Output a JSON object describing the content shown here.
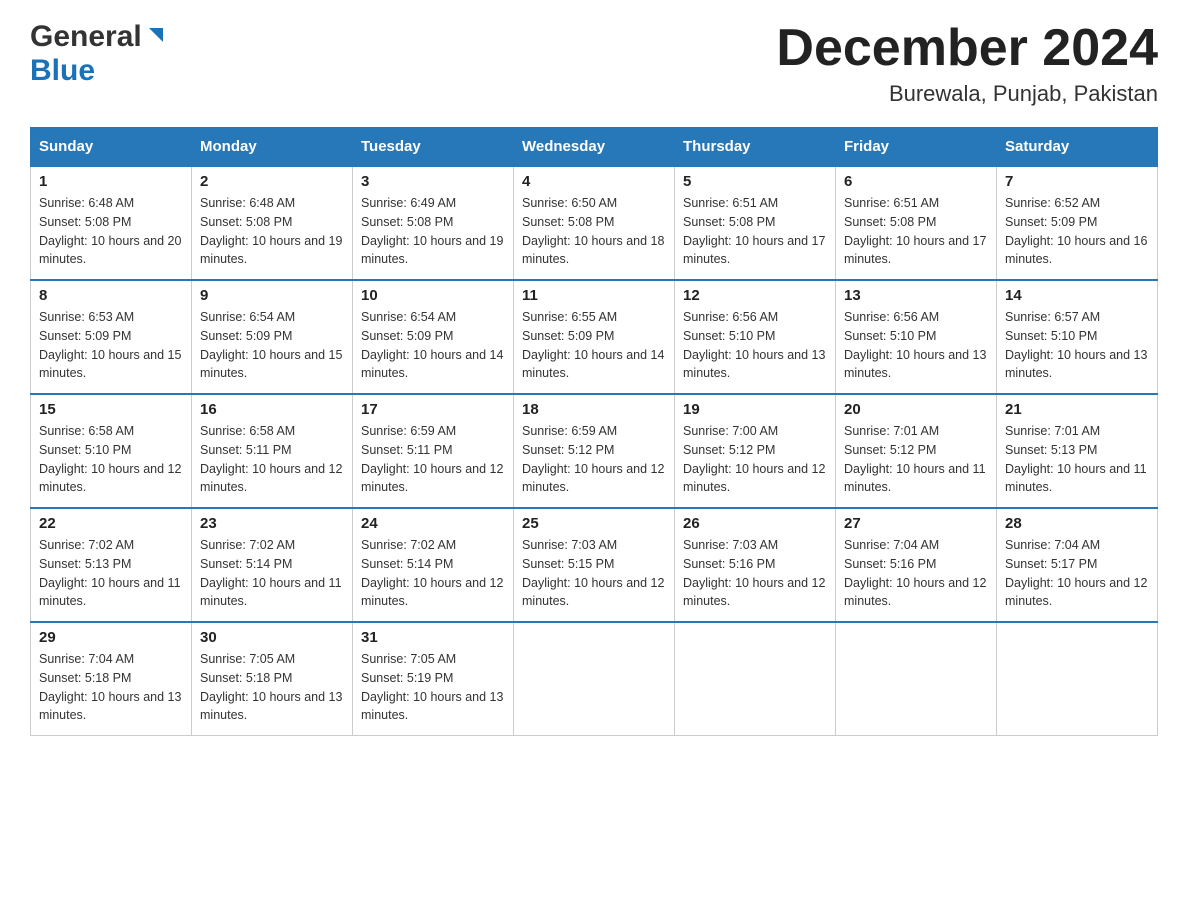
{
  "header": {
    "logo": {
      "general_text": "General",
      "blue_text": "Blue"
    },
    "title": "December 2024",
    "location": "Burewala, Punjab, Pakistan"
  },
  "weekdays": [
    "Sunday",
    "Monday",
    "Tuesday",
    "Wednesday",
    "Thursday",
    "Friday",
    "Saturday"
  ],
  "weeks": [
    [
      {
        "day": "1",
        "sunrise": "6:48 AM",
        "sunset": "5:08 PM",
        "daylight": "10 hours and 20 minutes."
      },
      {
        "day": "2",
        "sunrise": "6:48 AM",
        "sunset": "5:08 PM",
        "daylight": "10 hours and 19 minutes."
      },
      {
        "day": "3",
        "sunrise": "6:49 AM",
        "sunset": "5:08 PM",
        "daylight": "10 hours and 19 minutes."
      },
      {
        "day": "4",
        "sunrise": "6:50 AM",
        "sunset": "5:08 PM",
        "daylight": "10 hours and 18 minutes."
      },
      {
        "day": "5",
        "sunrise": "6:51 AM",
        "sunset": "5:08 PM",
        "daylight": "10 hours and 17 minutes."
      },
      {
        "day": "6",
        "sunrise": "6:51 AM",
        "sunset": "5:08 PM",
        "daylight": "10 hours and 17 minutes."
      },
      {
        "day": "7",
        "sunrise": "6:52 AM",
        "sunset": "5:09 PM",
        "daylight": "10 hours and 16 minutes."
      }
    ],
    [
      {
        "day": "8",
        "sunrise": "6:53 AM",
        "sunset": "5:09 PM",
        "daylight": "10 hours and 15 minutes."
      },
      {
        "day": "9",
        "sunrise": "6:54 AM",
        "sunset": "5:09 PM",
        "daylight": "10 hours and 15 minutes."
      },
      {
        "day": "10",
        "sunrise": "6:54 AM",
        "sunset": "5:09 PM",
        "daylight": "10 hours and 14 minutes."
      },
      {
        "day": "11",
        "sunrise": "6:55 AM",
        "sunset": "5:09 PM",
        "daylight": "10 hours and 14 minutes."
      },
      {
        "day": "12",
        "sunrise": "6:56 AM",
        "sunset": "5:10 PM",
        "daylight": "10 hours and 13 minutes."
      },
      {
        "day": "13",
        "sunrise": "6:56 AM",
        "sunset": "5:10 PM",
        "daylight": "10 hours and 13 minutes."
      },
      {
        "day": "14",
        "sunrise": "6:57 AM",
        "sunset": "5:10 PM",
        "daylight": "10 hours and 13 minutes."
      }
    ],
    [
      {
        "day": "15",
        "sunrise": "6:58 AM",
        "sunset": "5:10 PM",
        "daylight": "10 hours and 12 minutes."
      },
      {
        "day": "16",
        "sunrise": "6:58 AM",
        "sunset": "5:11 PM",
        "daylight": "10 hours and 12 minutes."
      },
      {
        "day": "17",
        "sunrise": "6:59 AM",
        "sunset": "5:11 PM",
        "daylight": "10 hours and 12 minutes."
      },
      {
        "day": "18",
        "sunrise": "6:59 AM",
        "sunset": "5:12 PM",
        "daylight": "10 hours and 12 minutes."
      },
      {
        "day": "19",
        "sunrise": "7:00 AM",
        "sunset": "5:12 PM",
        "daylight": "10 hours and 12 minutes."
      },
      {
        "day": "20",
        "sunrise": "7:01 AM",
        "sunset": "5:12 PM",
        "daylight": "10 hours and 11 minutes."
      },
      {
        "day": "21",
        "sunrise": "7:01 AM",
        "sunset": "5:13 PM",
        "daylight": "10 hours and 11 minutes."
      }
    ],
    [
      {
        "day": "22",
        "sunrise": "7:02 AM",
        "sunset": "5:13 PM",
        "daylight": "10 hours and 11 minutes."
      },
      {
        "day": "23",
        "sunrise": "7:02 AM",
        "sunset": "5:14 PM",
        "daylight": "10 hours and 11 minutes."
      },
      {
        "day": "24",
        "sunrise": "7:02 AM",
        "sunset": "5:14 PM",
        "daylight": "10 hours and 12 minutes."
      },
      {
        "day": "25",
        "sunrise": "7:03 AM",
        "sunset": "5:15 PM",
        "daylight": "10 hours and 12 minutes."
      },
      {
        "day": "26",
        "sunrise": "7:03 AM",
        "sunset": "5:16 PM",
        "daylight": "10 hours and 12 minutes."
      },
      {
        "day": "27",
        "sunrise": "7:04 AM",
        "sunset": "5:16 PM",
        "daylight": "10 hours and 12 minutes."
      },
      {
        "day": "28",
        "sunrise": "7:04 AM",
        "sunset": "5:17 PM",
        "daylight": "10 hours and 12 minutes."
      }
    ],
    [
      {
        "day": "29",
        "sunrise": "7:04 AM",
        "sunset": "5:18 PM",
        "daylight": "10 hours and 13 minutes."
      },
      {
        "day": "30",
        "sunrise": "7:05 AM",
        "sunset": "5:18 PM",
        "daylight": "10 hours and 13 minutes."
      },
      {
        "day": "31",
        "sunrise": "7:05 AM",
        "sunset": "5:19 PM",
        "daylight": "10 hours and 13 minutes."
      },
      null,
      null,
      null,
      null
    ]
  ],
  "labels": {
    "sunrise_prefix": "Sunrise: ",
    "sunset_prefix": "Sunset: ",
    "daylight_prefix": "Daylight: "
  }
}
